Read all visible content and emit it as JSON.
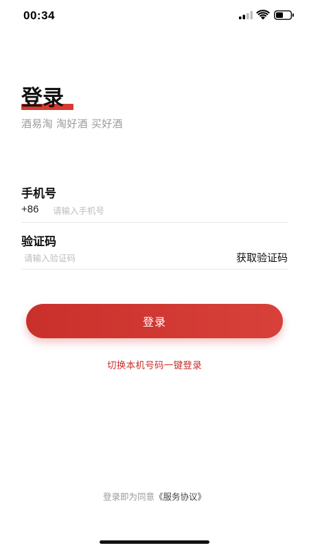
{
  "status_bar": {
    "time": "00:34",
    "icons": [
      "signal-icon",
      "wifi-icon",
      "battery-icon"
    ]
  },
  "header": {
    "title": "登录",
    "subtitle": "酒易淘 淘好酒 买好酒"
  },
  "form": {
    "phone_label": "手机号",
    "country_code": "+86",
    "phone_placeholder": "请输入手机号",
    "code_label": "验证码",
    "code_placeholder": "请输入验证码",
    "get_code_label": "获取验证码"
  },
  "actions": {
    "login_label": "登录",
    "switch_label": "切换本机号码一键登录"
  },
  "agreement": {
    "prefix": "登录即为同意",
    "link": "《服务协议》"
  },
  "colors": {
    "accent": "#d63a30",
    "link": "#c8302b",
    "muted_text": "#9a9a9a"
  }
}
